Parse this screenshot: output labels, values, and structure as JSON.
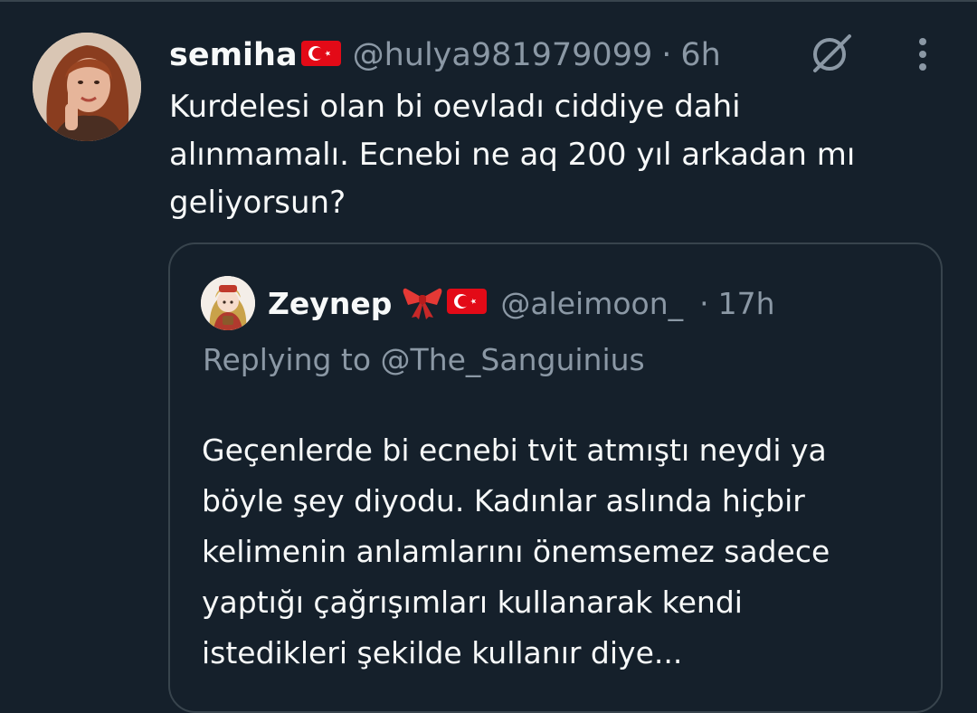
{
  "tweet": {
    "display_name": "semiha",
    "handle": "@hulya981979099",
    "separator": "·",
    "time": "6h",
    "text": "Kurdelesi olan bi oevladı ciddiye dahi\nalınmamalı. Ecnebi ne aq 200 yıl arkadan mı\ngeliyorsun?",
    "name_emoji": "turkey-flag",
    "actions": [
      "grok-icon",
      "more-options-icon"
    ]
  },
  "quote": {
    "display_name": "Zeynep",
    "name_emojis": [
      "ribbon",
      "turkey-flag"
    ],
    "handle": "@aleimoon_",
    "separator": "·",
    "time": "17h",
    "replying_to": "Replying to @The_Sanguinius",
    "text": "Geçenlerde bi ecnebi tvit atmıştı neydi ya\nböyle şey diyodu. Kadınlar aslında hiçbir\nkelimenin anlamlarını önemsemez sadece\nyaptığı çağrışımları kullanarak kendi\nistedikleri şekilde kullanır diye..."
  },
  "colors": {
    "background": "#15202b",
    "text_primary": "#f7f9f9",
    "text_secondary": "#8b98a5",
    "border": "#38444d",
    "flag_red": "#e30a17"
  }
}
